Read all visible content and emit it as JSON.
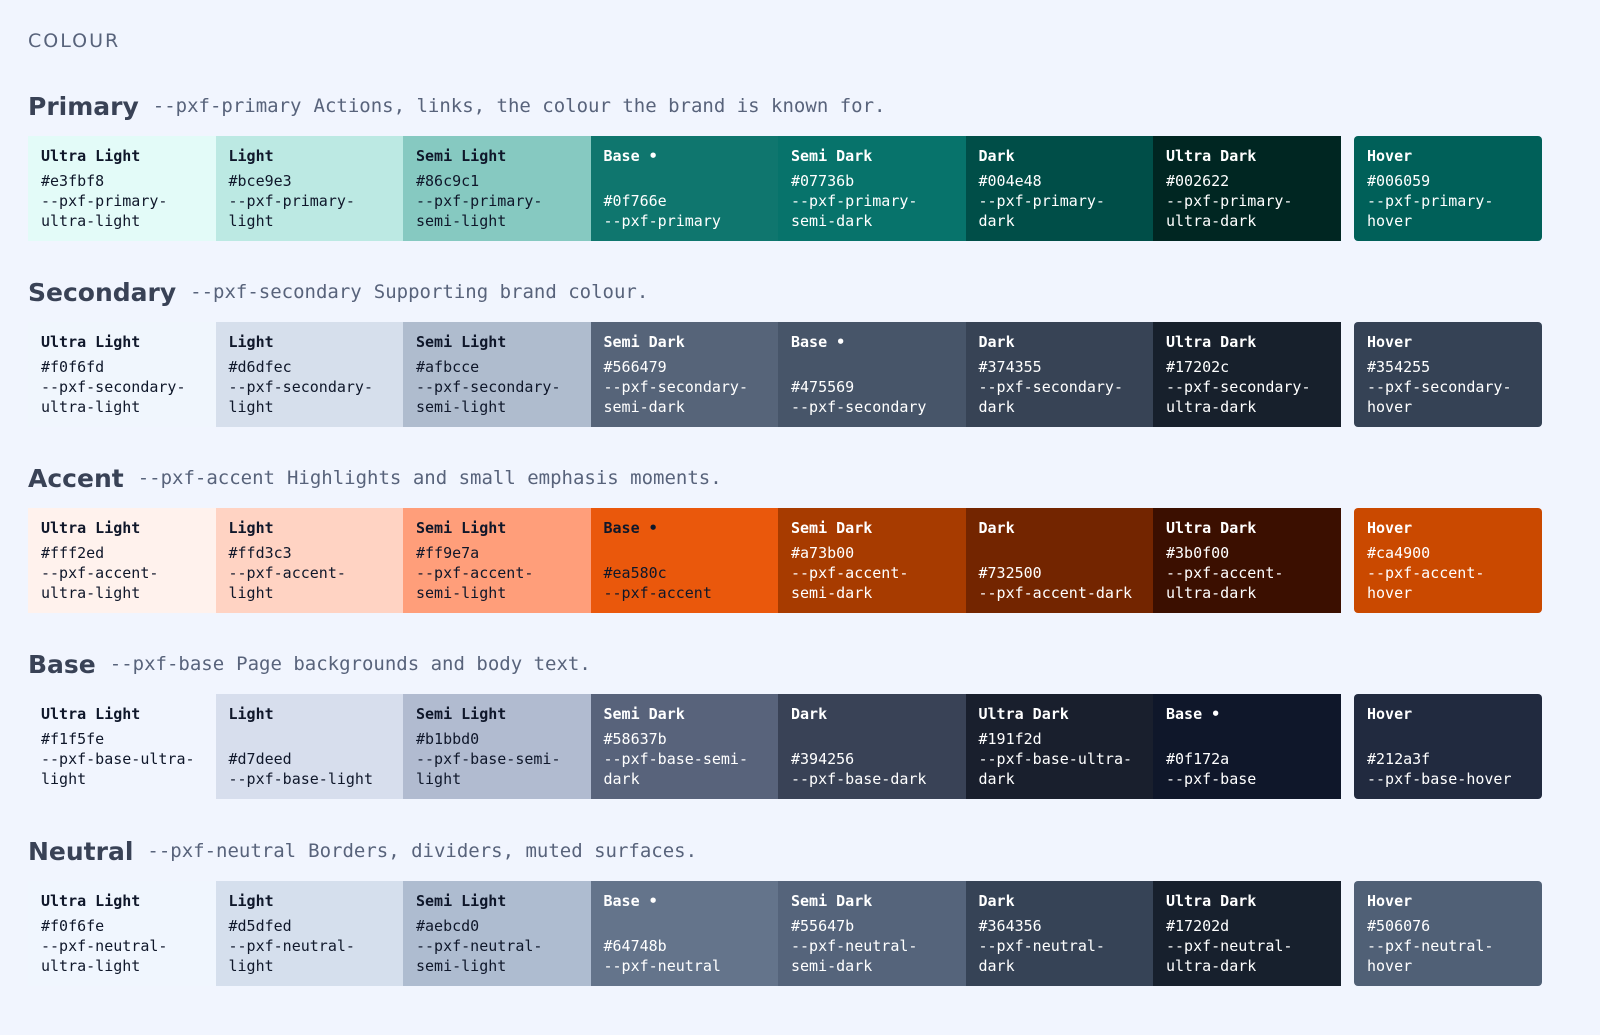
{
  "page_label": "COLOUR",
  "sections": [
    {
      "title": "Primary",
      "var": "--pxf-primary",
      "desc": "Actions, links, the colour the brand is known for.",
      "swatches": [
        {
          "name": "Ultra Light",
          "hex": "#e3fbf8",
          "var": "--pxf-primary-ultra-light",
          "bg": "#e3fbf8",
          "fg": "#0f172a"
        },
        {
          "name": "Light",
          "hex": "#bce9e3",
          "var": "--pxf-primary-light",
          "bg": "#bce9e3",
          "fg": "#0f172a"
        },
        {
          "name": "Semi Light",
          "hex": "#86c9c1",
          "var": "--pxf-primary-semi-light",
          "bg": "#86c9c1",
          "fg": "#0f172a"
        },
        {
          "name": "Base •",
          "hex": "#0f766e",
          "var": "--pxf-primary",
          "bg": "#0f766e",
          "fg": "#ffffff"
        },
        {
          "name": "Semi Dark",
          "hex": "#07736b",
          "var": "--pxf-primary-semi-dark",
          "bg": "#07736b",
          "fg": "#ffffff"
        },
        {
          "name": "Dark",
          "hex": "#004e48",
          "var": "--pxf-primary-dark",
          "bg": "#004e48",
          "fg": "#ffffff"
        },
        {
          "name": "Ultra Dark",
          "hex": "#002622",
          "var": "--pxf-primary-ultra-dark",
          "bg": "#002622",
          "fg": "#ffffff"
        },
        {
          "name": "Hover",
          "hex": "#006059",
          "var": "--pxf-primary-hover",
          "bg": "#006059",
          "fg": "#ffffff"
        }
      ]
    },
    {
      "title": "Secondary",
      "var": "--pxf-secondary",
      "desc": "Supporting brand colour.",
      "swatches": [
        {
          "name": "Ultra Light",
          "hex": "#f0f6fd",
          "var": "--pxf-secondary-ultra-light",
          "bg": "#f0f6fd",
          "fg": "#0f172a"
        },
        {
          "name": "Light",
          "hex": "#d6dfec",
          "var": "--pxf-secondary-light",
          "bg": "#d6dfec",
          "fg": "#0f172a"
        },
        {
          "name": "Semi Light",
          "hex": "#afbcce",
          "var": "--pxf-secondary-semi-light",
          "bg": "#afbcce",
          "fg": "#0f172a"
        },
        {
          "name": "Semi Dark",
          "hex": "#566479",
          "var": "--pxf-secondary-semi-dark",
          "bg": "#566479",
          "fg": "#ffffff"
        },
        {
          "name": "Base •",
          "hex": "#475569",
          "var": "--pxf-secondary",
          "bg": "#475569",
          "fg": "#ffffff"
        },
        {
          "name": "Dark",
          "hex": "#374355",
          "var": "--pxf-secondary-dark",
          "bg": "#374355",
          "fg": "#ffffff"
        },
        {
          "name": "Ultra Dark",
          "hex": "#17202c",
          "var": "--pxf-secondary-ultra-dark",
          "bg": "#17202c",
          "fg": "#ffffff"
        },
        {
          "name": "Hover",
          "hex": "#354255",
          "var": "--pxf-secondary-hover",
          "bg": "#354255",
          "fg": "#ffffff"
        }
      ]
    },
    {
      "title": "Accent",
      "var": "--pxf-accent",
      "desc": "Highlights and small emphasis moments.",
      "swatches": [
        {
          "name": "Ultra Light",
          "hex": "#fff2ed",
          "var": "--pxf-accent-ultra-light",
          "bg": "#fff2ed",
          "fg": "#0f172a"
        },
        {
          "name": "Light",
          "hex": "#ffd3c3",
          "var": "--pxf-accent-light",
          "bg": "#ffd3c3",
          "fg": "#0f172a"
        },
        {
          "name": "Semi Light",
          "hex": "#ff9e7a",
          "var": "--pxf-accent-semi-light",
          "bg": "#ff9e7a",
          "fg": "#0f172a"
        },
        {
          "name": "Base •",
          "hex": "#ea580c",
          "var": "--pxf-accent",
          "bg": "#ea580c",
          "fg": "#0f172a"
        },
        {
          "name": "Semi Dark",
          "hex": "#a73b00",
          "var": "--pxf-accent-semi-dark",
          "bg": "#a73b00",
          "fg": "#ffffff"
        },
        {
          "name": "Dark",
          "hex": "#732500",
          "var": "--pxf-accent-dark",
          "bg": "#732500",
          "fg": "#ffffff"
        },
        {
          "name": "Ultra Dark",
          "hex": "#3b0f00",
          "var": "--pxf-accent-ultra-dark",
          "bg": "#3b0f00",
          "fg": "#ffffff"
        },
        {
          "name": "Hover",
          "hex": "#ca4900",
          "var": "--pxf-accent-hover",
          "bg": "#ca4900",
          "fg": "#ffffff"
        }
      ]
    },
    {
      "title": "Base",
      "var": "--pxf-base",
      "desc": "Page backgrounds and body text.",
      "swatches": [
        {
          "name": "Ultra Light",
          "hex": "#f1f5fe",
          "var": "--pxf-base-ultra-light",
          "bg": "#f1f5fe",
          "fg": "#0f172a"
        },
        {
          "name": "Light",
          "hex": "#d7deed",
          "var": "--pxf-base-light",
          "bg": "#d7deed",
          "fg": "#0f172a"
        },
        {
          "name": "Semi Light",
          "hex": "#b1bbd0",
          "var": "--pxf-base-semi-light",
          "bg": "#b1bbd0",
          "fg": "#0f172a"
        },
        {
          "name": "Semi Dark",
          "hex": "#58637b",
          "var": "--pxf-base-semi-dark",
          "bg": "#58637b",
          "fg": "#ffffff"
        },
        {
          "name": "Dark",
          "hex": "#394256",
          "var": "--pxf-base-dark",
          "bg": "#394256",
          "fg": "#ffffff"
        },
        {
          "name": "Ultra Dark",
          "hex": "#191f2d",
          "var": "--pxf-base-ultra-dark",
          "bg": "#191f2d",
          "fg": "#ffffff"
        },
        {
          "name": "Base •",
          "hex": "#0f172a",
          "var": "--pxf-base",
          "bg": "#0f172a",
          "fg": "#ffffff"
        },
        {
          "name": "Hover",
          "hex": "#212a3f",
          "var": "--pxf-base-hover",
          "bg": "#212a3f",
          "fg": "#ffffff"
        }
      ]
    },
    {
      "title": "Neutral",
      "var": "--pxf-neutral",
      "desc": "Borders, dividers, muted surfaces.",
      "swatches": [
        {
          "name": "Ultra Light",
          "hex": "#f0f6fe",
          "var": "--pxf-neutral-ultra-light",
          "bg": "#f0f6fe",
          "fg": "#0f172a"
        },
        {
          "name": "Light",
          "hex": "#d5dfed",
          "var": "--pxf-neutral-light",
          "bg": "#d5dfed",
          "fg": "#0f172a"
        },
        {
          "name": "Semi Light",
          "hex": "#aebcd0",
          "var": "--pxf-neutral-semi-light",
          "bg": "#aebcd0",
          "fg": "#0f172a"
        },
        {
          "name": "Base •",
          "hex": "#64748b",
          "var": "--pxf-neutral",
          "bg": "#64748b",
          "fg": "#ffffff"
        },
        {
          "name": "Semi Dark",
          "hex": "#55647b",
          "var": "--pxf-neutral-semi-dark",
          "bg": "#55647b",
          "fg": "#ffffff"
        },
        {
          "name": "Dark",
          "hex": "#364356",
          "var": "--pxf-neutral-dark",
          "bg": "#364356",
          "fg": "#ffffff"
        },
        {
          "name": "Ultra Dark",
          "hex": "#17202d",
          "var": "--pxf-neutral-ultra-dark",
          "bg": "#17202d",
          "fg": "#ffffff"
        },
        {
          "name": "Hover",
          "hex": "#506076",
          "var": "--pxf-neutral-hover",
          "bg": "#506076",
          "fg": "#ffffff"
        }
      ]
    }
  ]
}
